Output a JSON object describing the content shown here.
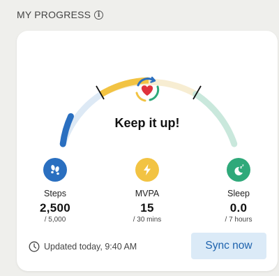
{
  "header": {
    "title": "MY PROGRESS"
  },
  "gauge": {
    "message": "Keep it up!"
  },
  "metrics": [
    {
      "label": "Steps",
      "value": "2,500",
      "target": "/ 5,000",
      "icon": "footsteps-icon",
      "color": "#2a6fc0"
    },
    {
      "label": "MVPA",
      "value": "15",
      "target": "/ 30 mins",
      "icon": "lightning-icon",
      "color": "#f2c343"
    },
    {
      "label": "Sleep",
      "value": "0.0",
      "target": "/ 7 hours",
      "icon": "moon-zzz-icon",
      "color": "#2fa97a"
    }
  ],
  "progress": {
    "steps": 0.5,
    "mvpa": 0.5,
    "sleep": 0.0
  },
  "footer": {
    "updated_text": "Updated today, 9:40 AM",
    "sync_label": "Sync now"
  },
  "colors": {
    "steps_track": "#dde9f5",
    "mvpa_track": "#f7edd2",
    "sleep_track": "#c9e8dc"
  }
}
